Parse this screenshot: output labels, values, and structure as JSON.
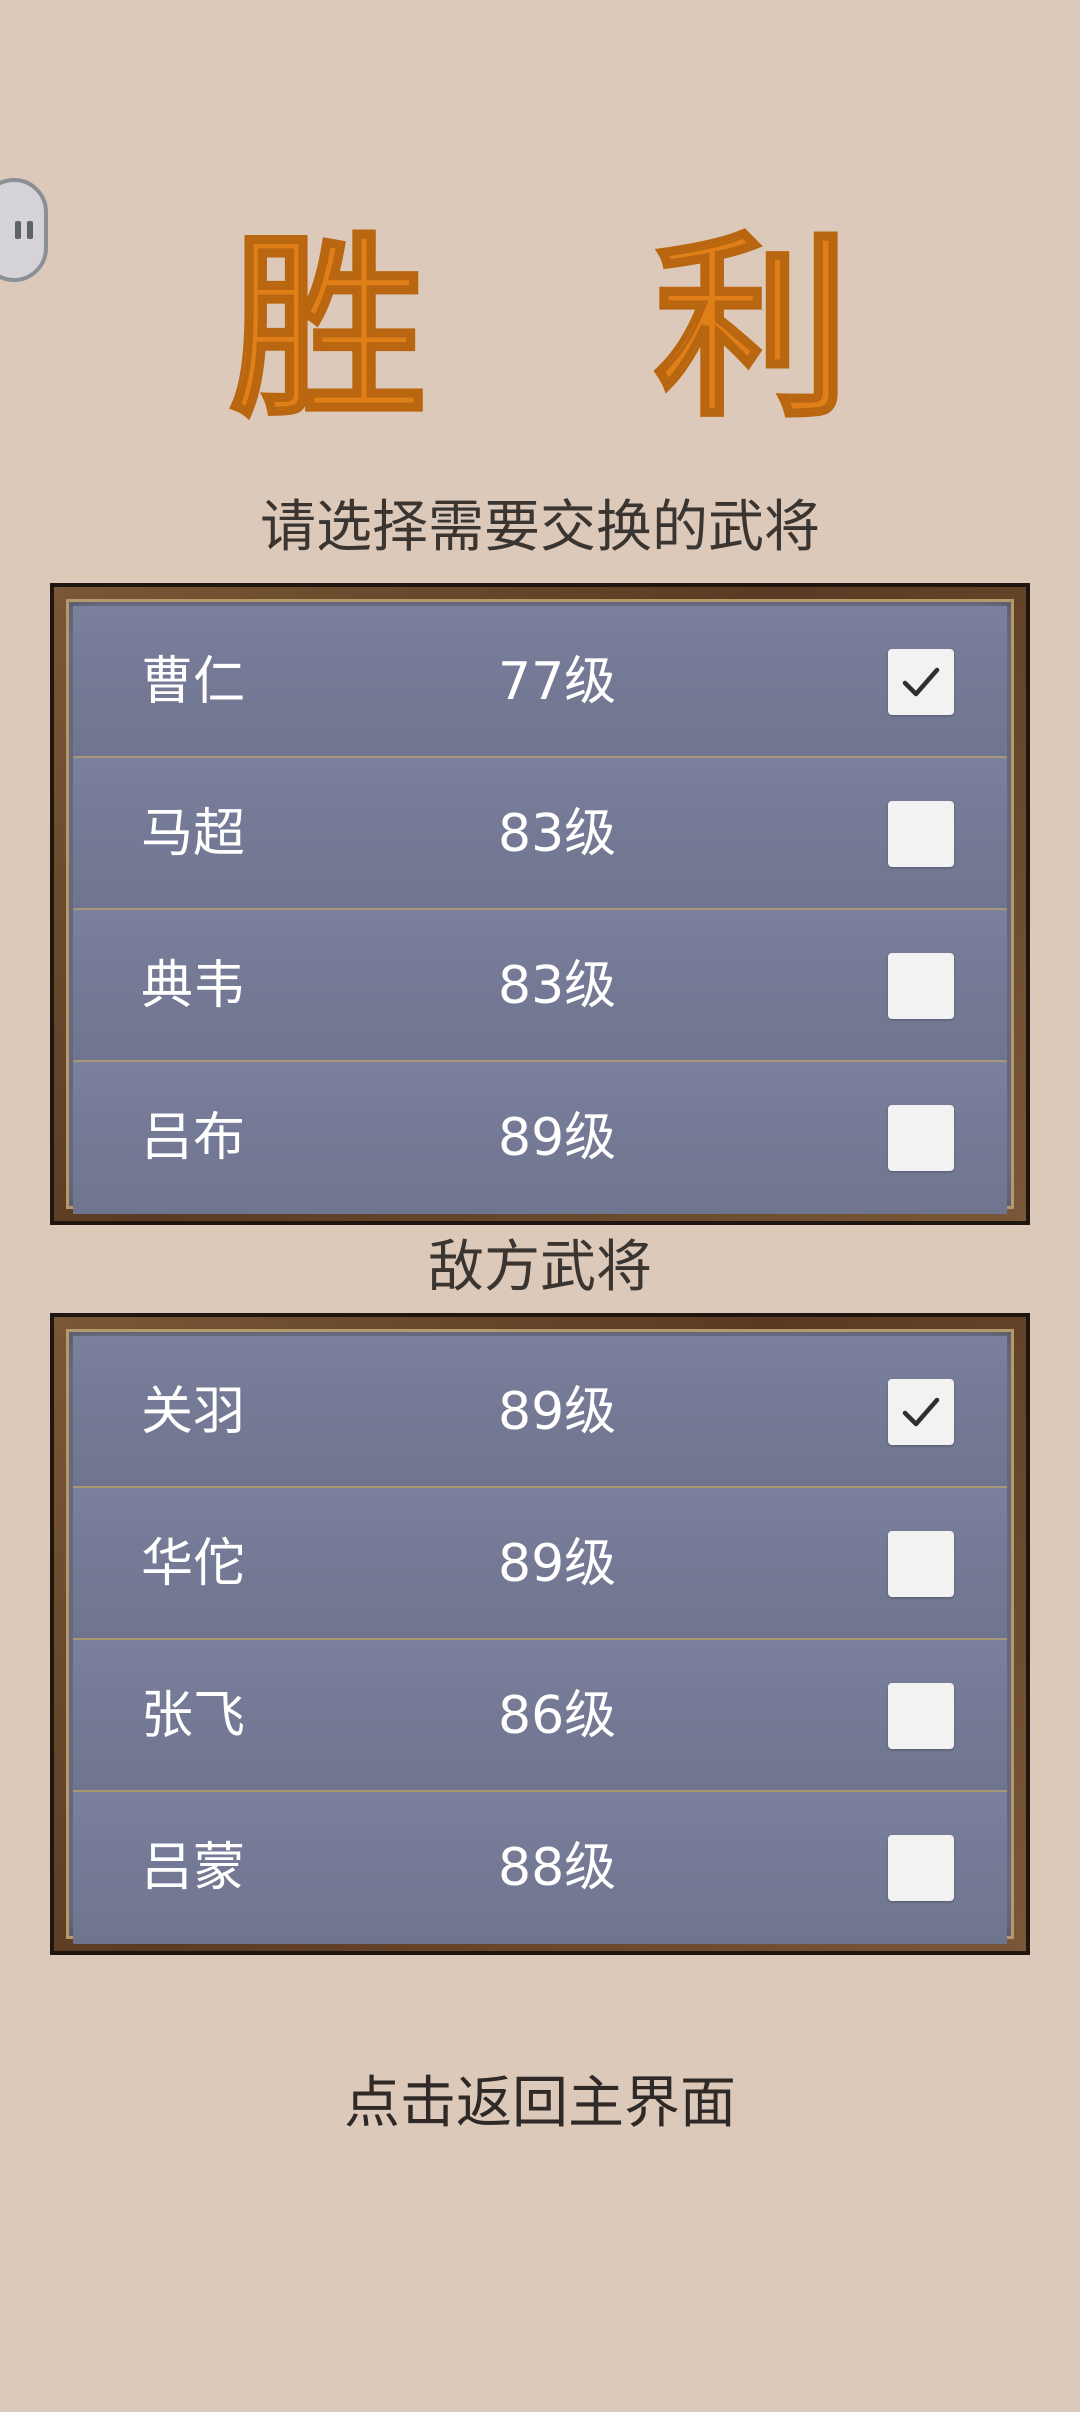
{
  "title": "胜 利",
  "own_section": {
    "label": "请选择需要交换的武将",
    "rows": [
      {
        "name": "曹仁",
        "level": "77级",
        "checked": true
      },
      {
        "name": "马超",
        "level": "83级",
        "checked": false
      },
      {
        "name": "典韦",
        "level": "83级",
        "checked": false
      },
      {
        "name": "吕布",
        "level": "89级",
        "checked": false
      }
    ]
  },
  "enemy_section": {
    "label": "敌方武将",
    "rows": [
      {
        "name": "关羽",
        "level": "89级",
        "checked": true
      },
      {
        "name": "华佗",
        "level": "89级",
        "checked": false
      },
      {
        "name": "张飞",
        "level": "86级",
        "checked": false
      },
      {
        "name": "吕蒙",
        "level": "88级",
        "checked": false
      }
    ]
  },
  "back_label": "点击返回主界面",
  "icons": {
    "pause": "pause-icon",
    "check": "checkmark-icon"
  },
  "colors": {
    "background": "#dcc9ba",
    "title": "#e07f18",
    "panel": "#757a96",
    "frame": "#5a3a22"
  }
}
